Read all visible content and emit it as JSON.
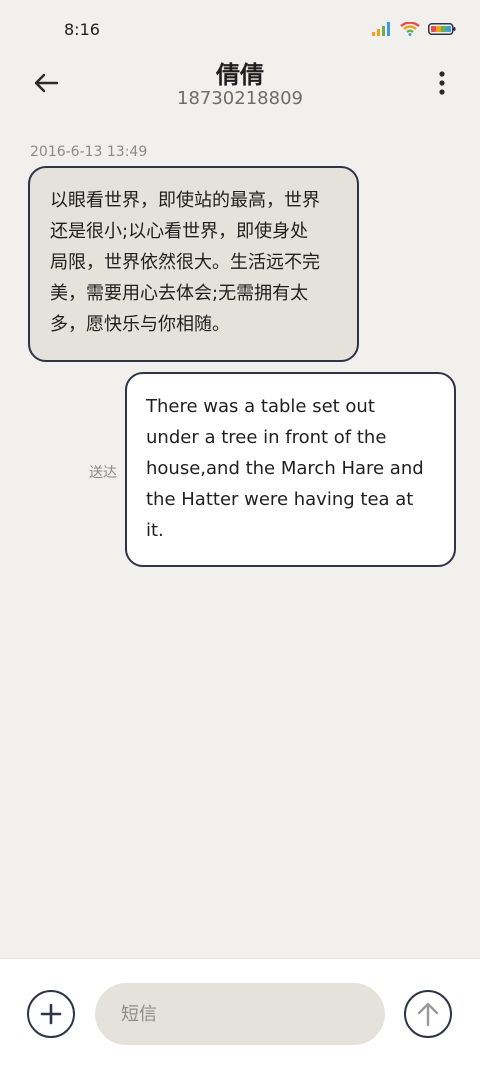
{
  "status_bar": {
    "time": "8:16",
    "icons": [
      "signal-icon",
      "wifi-icon",
      "battery-icon"
    ]
  },
  "header": {
    "title": "倩倩",
    "subtitle": "18730218809",
    "back_icon": "back-arrow-icon",
    "more_icon": "more-vertical-icon"
  },
  "conversation": {
    "timestamp": "2016-6-13 13:49",
    "messages": [
      {
        "direction": "incoming",
        "lines": [
          "以眼看世界，即使站的最高，世界",
          "还是很小;以心看世界，即使身处",
          "局限，世界依然很大。生活远不完",
          "美，需要用心去体会;无需拥有太",
          "多，愿快乐与你相随。"
        ]
      },
      {
        "direction": "outgoing",
        "status": "送达",
        "lines": [
          "There was a table set out",
          "under a tree in front of the",
          "house,and the March Hare and",
          "the Hatter were having tea at",
          "it."
        ]
      }
    ]
  },
  "composer": {
    "placeholder": "短信",
    "value": "",
    "add_icon": "plus-icon",
    "send_icon": "arrow-up-icon"
  },
  "colors": {
    "background": "#f1f0ed",
    "incoming_bubble": "#e5e2dc",
    "outgoing_bubble": "#ffffff",
    "bubble_border": "#2f3446",
    "secondary_text": "#8a8a8a"
  }
}
